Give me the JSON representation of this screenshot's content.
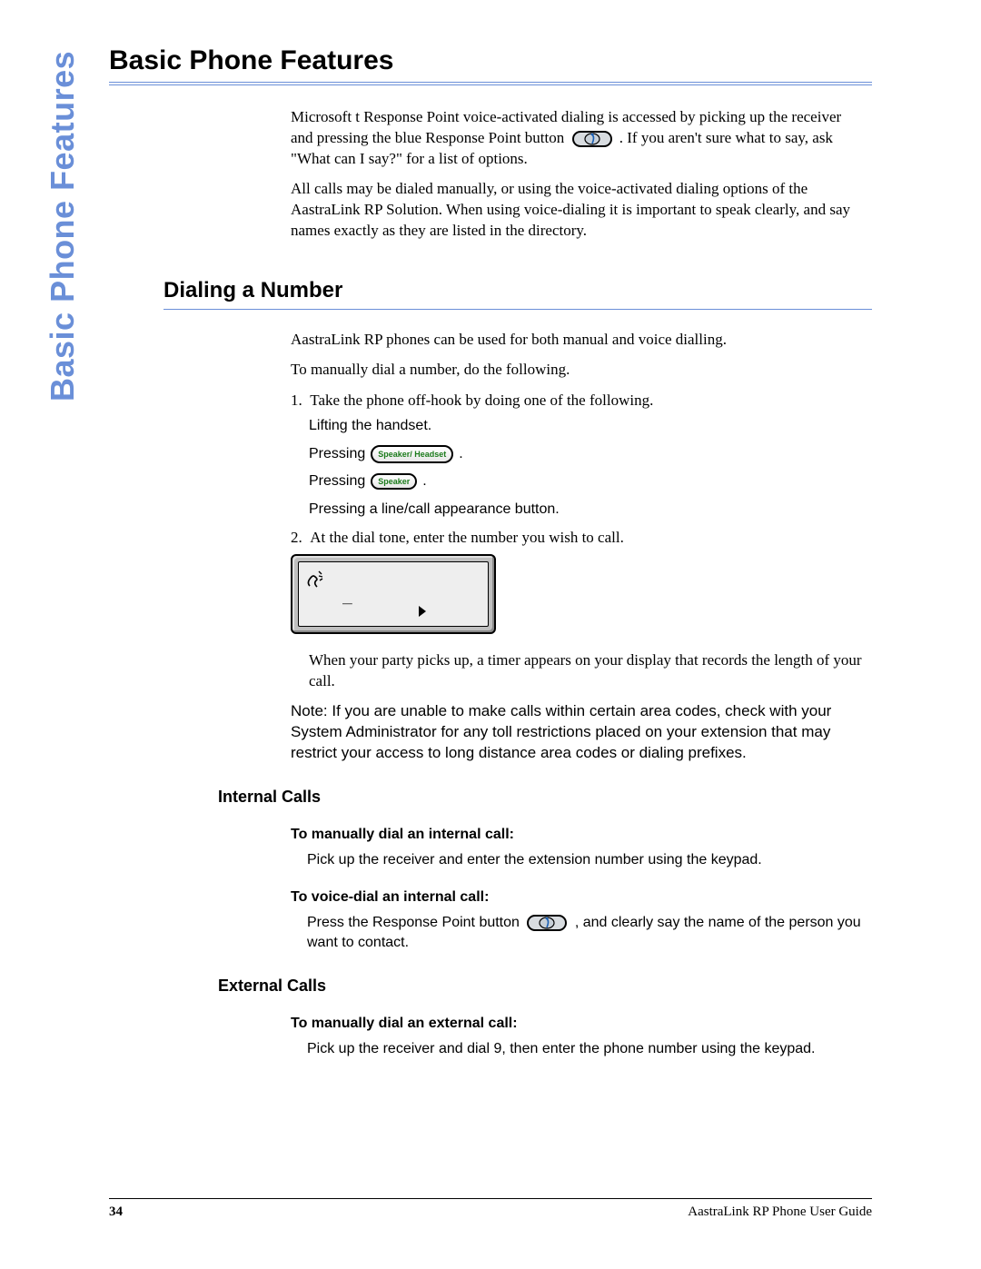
{
  "side_title": "Basic Phone Features",
  "h1": "Basic Phone Features",
  "intro": {
    "p1a": "Microsoft t Response Point voice-activated dialing is accessed by picking up the receiver and pressing the blue Response Point button ",
    "p1b": ". If you aren't sure what to say, ask \"What can I say?\" for a list of options.",
    "p2": "All calls may be dialed manually, or using the voice-activated dialing options of the AastraLink RP Solution. When using voice-dialing it is important to speak clearly, and say names exactly as they are listed in the directory."
  },
  "dialing": {
    "h2": "Dialing a Number",
    "p1": "AastraLink RP phones can be used for both manual and voice dialling.",
    "p2": "To manually dial a number, do the following.",
    "step1_label": "1.",
    "step1_text": "Take the phone off-hook by doing one of the following.",
    "sub_a": "Lifting the handset.",
    "sub_b_pre": "Pressing",
    "sub_b_btn": "Speaker/ Headset",
    "sub_b_post": ".",
    "sub_c_pre": "Pressing",
    "sub_c_btn": "Speaker",
    "sub_c_post": ".",
    "sub_d": "Pressing a line/call appearance button.",
    "step2_label": "2.",
    "step2_text": "At the dial tone, enter the number you wish to call.",
    "after_lcd": "When your party picks up, a timer appears on your display that records the length of your call.",
    "note_label": "Note:",
    "note_text": "If you are unable to make calls within certain area codes, check with your System Administrator for any toll restrictions placed on your extension that may restrict your access to long distance area codes or dialing prefixes."
  },
  "internal": {
    "h3": "Internal Calls",
    "manual_h4": "To manually dial an internal call:",
    "manual_body": "Pick up the receiver and enter the extension number using the keypad.",
    "voice_h4": "To voice-dial an internal call:",
    "voice_body_a": "Press the Response Point button ",
    "voice_body_b": ", and clearly say the name of the person you want to contact."
  },
  "external": {
    "h3": "External Calls",
    "manual_h4": "To manually dial an external call:",
    "manual_body": "Pick up the receiver and dial 9, then enter the phone number using the keypad."
  },
  "footer": {
    "page": "34",
    "doc": "AastraLink RP Phone User Guide"
  },
  "icons": {
    "rp_button": "response-point-button-icon",
    "speaker_headset": "speaker-headset-key-icon",
    "speaker": "speaker-key-icon",
    "lcd_handset": "handset-icon",
    "lcd_cursor": "cursor-right-icon"
  }
}
